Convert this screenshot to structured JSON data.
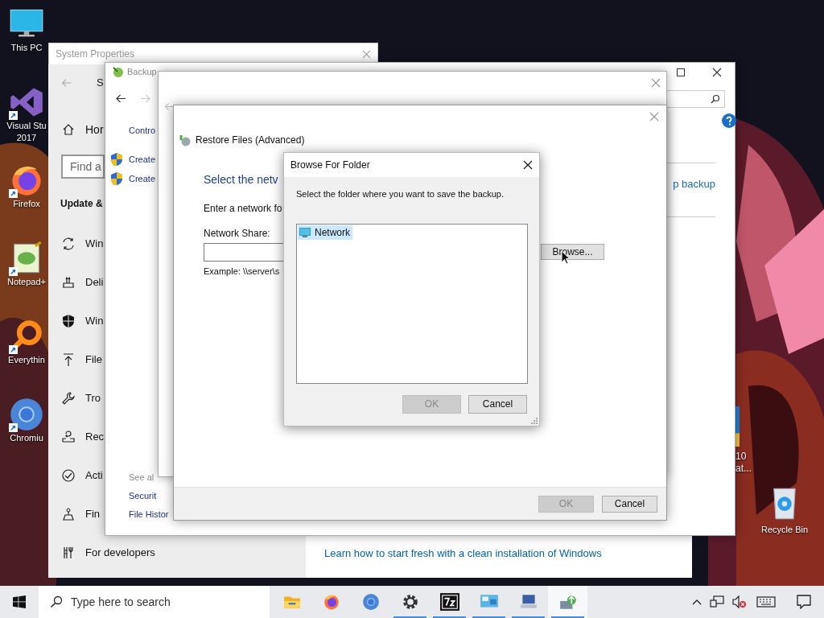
{
  "desktop_icons": [
    {
      "kind": "monitor",
      "shortcut": false,
      "lines": [
        "This PC"
      ]
    },
    {
      "kind": "vs",
      "shortcut": true,
      "lines": [
        "Visual Stu",
        "2017"
      ]
    },
    {
      "kind": "firefox",
      "shortcut": true,
      "lines": [
        "Firefox"
      ]
    },
    {
      "kind": "notepad",
      "shortcut": true,
      "lines": [
        "Notepad+"
      ]
    },
    {
      "kind": "everything",
      "shortcut": true,
      "lines": [
        "Everythin"
      ]
    },
    {
      "kind": "chromium",
      "shortcut": true,
      "lines": [
        "Chromiu"
      ]
    }
  ],
  "desktop_icons_right": [
    {
      "kind": "app",
      "lines": [
        "10",
        "at..."
      ]
    },
    {
      "kind": "recycle",
      "lines": [
        "Recycle Bin"
      ]
    }
  ],
  "system_properties": {
    "title": "System Properties"
  },
  "settings": {
    "title": "S",
    "home": "Hor",
    "search": {
      "placeholder": "Find a"
    },
    "section": "Update &",
    "items": [
      {
        "kind": "sync",
        "label": "Win"
      },
      {
        "kind": "delivery",
        "label": "Deli"
      },
      {
        "kind": "shield",
        "label": "Win"
      },
      {
        "kind": "upload",
        "label": "File"
      },
      {
        "kind": "wrench",
        "label": "Tro"
      },
      {
        "kind": "recovery",
        "label": "Rec"
      },
      {
        "kind": "check",
        "label": "Acti"
      },
      {
        "kind": "find",
        "label": "Fin"
      },
      {
        "kind": "developers",
        "label": "For developers"
      }
    ],
    "bottom_link": "Learn how to start fresh with a clean installation of Windows"
  },
  "backup_window": {
    "title": "Backup",
    "breadcrumb": "Contro",
    "tasks": [
      "Create",
      "Create"
    ],
    "link": "p backup",
    "see_also": "See al",
    "see_also_links": [
      "Securit",
      "File Histor"
    ]
  },
  "restore_window": {
    "title": "Restore Files (Advanced)",
    "heading": "Select the netv",
    "instruction": "Enter a network fo",
    "field_label": "Network Share:",
    "example": "Example: \\\\server\\s",
    "browse_button": "Browse...",
    "buttons": [
      {
        "label": "OK",
        "disabled": true
      },
      {
        "label": "Cancel",
        "disabled": false
      }
    ]
  },
  "browse_dialog": {
    "title": "Browse For Folder",
    "prompt": "Select the folder where you want to save the backup.",
    "tree": [
      {
        "label": "Network",
        "selected": true
      }
    ],
    "buttons": [
      {
        "label": "OK",
        "disabled": true
      },
      {
        "label": "Cancel",
        "disabled": false
      }
    ]
  },
  "taskbar": {
    "search_placeholder": "Type here to search",
    "apps": [
      {
        "kind": "explorer",
        "running": false,
        "selected": false
      },
      {
        "kind": "firefox",
        "running": false,
        "selected": false
      },
      {
        "kind": "chromium",
        "running": false,
        "selected": false
      },
      {
        "kind": "gear",
        "running": true,
        "selected": false
      },
      {
        "kind": "archive",
        "running": true,
        "selected": false
      },
      {
        "kind": "control",
        "running": true,
        "selected": false
      },
      {
        "kind": "computer",
        "running": true,
        "selected": false
      },
      {
        "kind": "backup",
        "running": true,
        "selected": true
      }
    ]
  }
}
